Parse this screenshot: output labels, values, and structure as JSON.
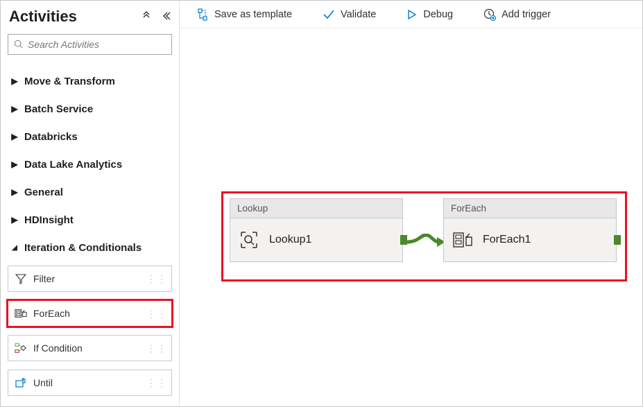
{
  "sidebar": {
    "title": "Activities",
    "search_placeholder": "Search Activities",
    "categories": [
      {
        "label": "Move & Transform",
        "expanded": false
      },
      {
        "label": "Batch Service",
        "expanded": false
      },
      {
        "label": "Databricks",
        "expanded": false
      },
      {
        "label": "Data Lake Analytics",
        "expanded": false
      },
      {
        "label": "General",
        "expanded": false
      },
      {
        "label": "HDInsight",
        "expanded": false
      },
      {
        "label": "Iteration & Conditionals",
        "expanded": true
      }
    ],
    "iteration_items": [
      {
        "label": "Filter",
        "icon": "filter-icon",
        "highlighted": false
      },
      {
        "label": "ForEach",
        "icon": "foreach-icon",
        "highlighted": true
      },
      {
        "label": "If Condition",
        "icon": "if-icon",
        "highlighted": false
      },
      {
        "label": "Until",
        "icon": "until-icon",
        "highlighted": false
      }
    ]
  },
  "toolbar": {
    "save_template": "Save as template",
    "validate": "Validate",
    "debug": "Debug",
    "add_trigger": "Add trigger"
  },
  "canvas": {
    "nodes": [
      {
        "type_label": "Lookup",
        "name": "Lookup1",
        "icon": "lookup-icon"
      },
      {
        "type_label": "ForEach",
        "name": "ForEach1",
        "icon": "foreach-icon"
      }
    ]
  },
  "colors": {
    "highlight": "#e81123",
    "connector": "#4a8a2a",
    "toolbar_blue": "#0078d4"
  }
}
